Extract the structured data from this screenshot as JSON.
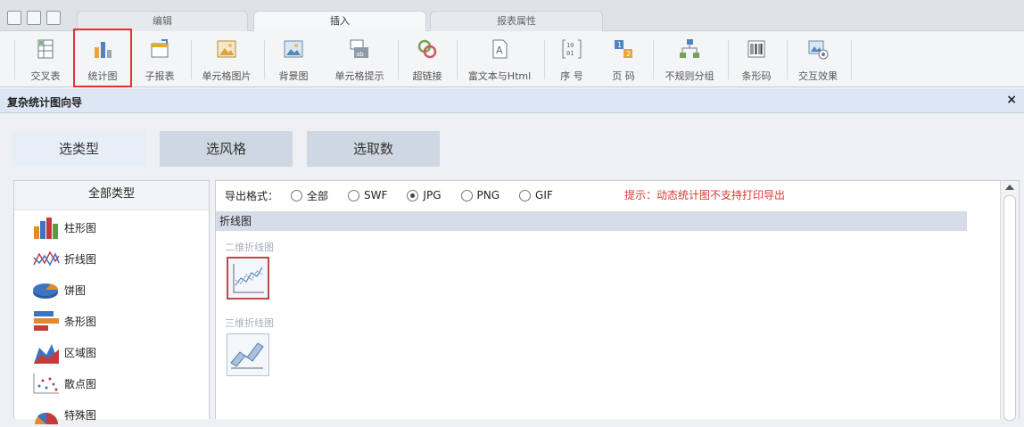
{
  "tabs": [
    {
      "label": "编辑"
    },
    {
      "label": "插入"
    },
    {
      "label": "报表属性"
    }
  ],
  "ribbon": {
    "items": [
      {
        "label": "交叉表",
        "icon": "crosstab-icon"
      },
      {
        "label": "统计图",
        "icon": "chart-icon"
      },
      {
        "label": "子报表",
        "icon": "subreport-icon"
      },
      {
        "label": "单元格图片",
        "icon": "cell-image-icon"
      },
      {
        "label": "背景图",
        "icon": "background-image-icon"
      },
      {
        "label": "单元格提示",
        "icon": "cell-tip-icon"
      },
      {
        "label": "超链接",
        "icon": "hyperlink-icon"
      },
      {
        "label": "富文本与Html",
        "icon": "richtext-icon"
      },
      {
        "label": "序 号",
        "icon": "serial-number-icon"
      },
      {
        "label": "页 码",
        "icon": "page-number-icon"
      },
      {
        "label": "不规则分组",
        "icon": "irregular-group-icon"
      },
      {
        "label": "条形码",
        "icon": "barcode-icon"
      },
      {
        "label": "交互效果",
        "icon": "interaction-icon"
      }
    ]
  },
  "dialog": {
    "title": "复杂统计图向导",
    "close": "×",
    "steps": [
      {
        "label": "选类型"
      },
      {
        "label": "选风格"
      },
      {
        "label": "选取数"
      }
    ],
    "left": {
      "header": "全部类型",
      "types": [
        {
          "label": "柱形图",
          "icon": "column-chart-icon"
        },
        {
          "label": "折线图",
          "icon": "line-chart-icon"
        },
        {
          "label": "饼图",
          "icon": "pie-chart-icon"
        },
        {
          "label": "条形图",
          "icon": "bar-chart-icon"
        },
        {
          "label": "区域图",
          "icon": "area-chart-icon"
        },
        {
          "label": "散点图",
          "icon": "scatter-chart-icon"
        },
        {
          "label": "特殊图",
          "icon": "special-chart-icon"
        }
      ]
    },
    "export": {
      "label": "导出格式：",
      "options": [
        {
          "label": "全部",
          "selected": false
        },
        {
          "label": "SWF",
          "selected": false
        },
        {
          "label": "JPG",
          "selected": true
        },
        {
          "label": "PNG",
          "selected": false
        },
        {
          "label": "GIF",
          "selected": false
        }
      ],
      "tip": "提示：动态统计图不支持打印导出"
    },
    "category": "折线图",
    "sub1": "二维折线图",
    "sub2": "三维折线图"
  },
  "colors": {
    "accent_red": "#e53333",
    "tip_red": "#d9382e",
    "dialog_header": "#dce6f4",
    "step_inactive": "#cfd7e3",
    "step_active": "#e7eef8"
  }
}
